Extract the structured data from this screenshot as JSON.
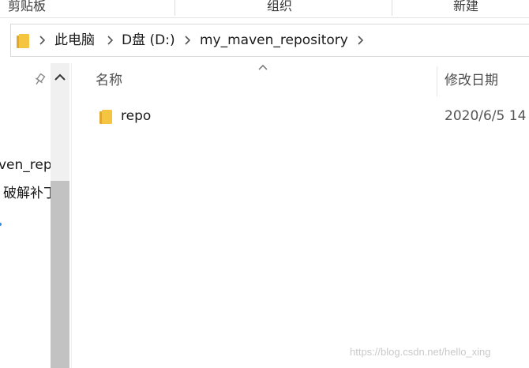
{
  "ribbon": {
    "groups": [
      "剪贴板",
      "组织",
      "新建"
    ]
  },
  "address": {
    "crumbs": [
      "此电脑",
      "D盘 (D:)",
      "my_maven_repository"
    ]
  },
  "nav": {
    "items": [
      "ven_repo",
      "破解补丁"
    ]
  },
  "columns": {
    "name": "名称",
    "modified": "修改日期"
  },
  "files": [
    {
      "name": "repo",
      "modified": "2020/6/5 14",
      "type": "folder"
    }
  ],
  "icons": {
    "folder": "folder-icon",
    "chevron": "chevron-right-icon",
    "pin": "pin-icon",
    "scroll_up": "scroll-up-icon",
    "sort": "sort-ascending-icon"
  },
  "colors": {
    "folder": "#f5c542",
    "folder_dark": "#e0a82e",
    "scrollbar_thumb": "#c2c2c2"
  },
  "watermark": "https://blog.csdn.net/hello_xing"
}
